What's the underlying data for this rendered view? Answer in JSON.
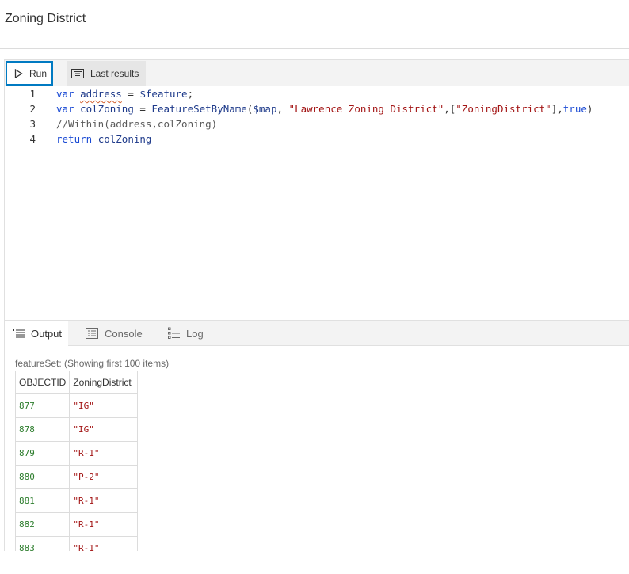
{
  "header": {
    "title": "Zoning District"
  },
  "toolbar": {
    "run_label": "Run",
    "last_results_label": "Last results"
  },
  "editor": {
    "lines": [
      {
        "number": "1",
        "tokens": [
          {
            "text": "var ",
            "type": "kw"
          },
          {
            "text": "address",
            "type": "id-squiggle"
          },
          {
            "text": " = ",
            "type": "pl"
          },
          {
            "text": "$feature",
            "type": "id"
          },
          {
            "text": ";",
            "type": "pl"
          }
        ]
      },
      {
        "number": "2",
        "tokens": [
          {
            "text": "var ",
            "type": "kw"
          },
          {
            "text": "colZoning",
            "type": "id"
          },
          {
            "text": " = ",
            "type": "pl"
          },
          {
            "text": "FeatureSetByName",
            "type": "id"
          },
          {
            "text": "(",
            "type": "pl"
          },
          {
            "text": "$map",
            "type": "id"
          },
          {
            "text": ", ",
            "type": "pl"
          },
          {
            "text": "\"Lawrence Zoning District\"",
            "type": "str"
          },
          {
            "text": ",[",
            "type": "pl"
          },
          {
            "text": "\"ZoningDistrict\"",
            "type": "str"
          },
          {
            "text": "],",
            "type": "pl"
          },
          {
            "text": "true",
            "type": "kw"
          },
          {
            "text": ")",
            "type": "pl"
          }
        ]
      },
      {
        "number": "3",
        "tokens": [
          {
            "text": "//Within(address,colZoning)",
            "type": "cmt"
          }
        ]
      },
      {
        "number": "4",
        "tokens": [
          {
            "text": "return ",
            "type": "kw"
          },
          {
            "text": "colZoning",
            "type": "id"
          }
        ]
      }
    ]
  },
  "tabs": [
    {
      "label": "Output",
      "icon": "output-list-icon",
      "active": true
    },
    {
      "label": "Console",
      "icon": "console-icon",
      "active": false
    },
    {
      "label": "Log",
      "icon": "log-list-icon",
      "active": false
    }
  ],
  "output": {
    "feature_set_label": "featureSet: (Showing first 100 items)",
    "columns": [
      "OBJECTID",
      "ZoningDistrict"
    ],
    "rows": [
      [
        "877",
        "\"IG\""
      ],
      [
        "878",
        "\"IG\""
      ],
      [
        "879",
        "\"R-1\""
      ],
      [
        "880",
        "\"P-2\""
      ],
      [
        "881",
        "\"R-1\""
      ],
      [
        "882",
        "\"R-1\""
      ],
      [
        "883",
        "\"R-1\""
      ]
    ]
  },
  "colors": {
    "accent": "#007ac2",
    "string": "#a31515",
    "keyword": "#1a4ad4",
    "number": "#2d7d2d"
  }
}
